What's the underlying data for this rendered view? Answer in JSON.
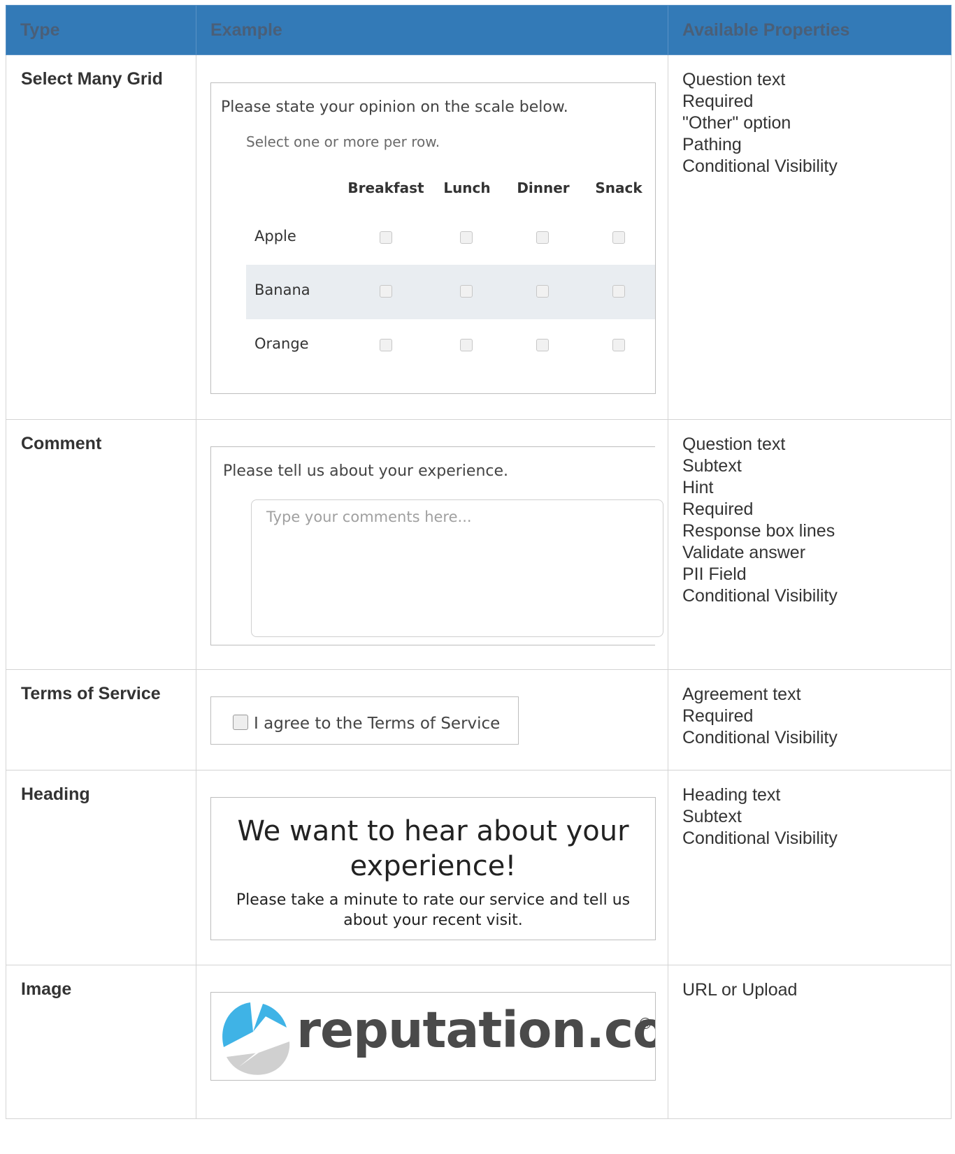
{
  "headers": {
    "type": "Type",
    "example": "Example",
    "props": "Available Properties"
  },
  "rows": [
    {
      "type": "Select Many Grid",
      "example": {
        "question": "Please state your opinion on the scale below.",
        "subtext": "Select one or more per row.",
        "columns": [
          "Breakfast",
          "Lunch",
          "Dinner",
          "Snack"
        ],
        "rows": [
          "Apple",
          "Banana",
          "Orange"
        ]
      },
      "props": [
        "Question text",
        "Required",
        "\"Other\" option",
        "Pathing",
        "Conditional Visibility"
      ]
    },
    {
      "type": "Comment",
      "example": {
        "question": "Please tell us about your experience.",
        "placeholder": "Type your comments here..."
      },
      "props": [
        "Question text",
        "Subtext",
        "Hint",
        "Required",
        "Response box lines",
        "Validate answer",
        "PII Field",
        "Conditional Visibility"
      ]
    },
    {
      "type": "Terms of Service",
      "example": {
        "label": "I agree to the Terms of Service"
      },
      "props": [
        "Agreement text",
        "Required",
        "Conditional Visibility"
      ]
    },
    {
      "type": "Heading",
      "example": {
        "heading_line1": "We want to hear about your",
        "heading_line2": "experience!",
        "subtext_line1": "Please take a minute to rate our service and tell us",
        "subtext_line2": "about your recent visit."
      },
      "props": [
        "Heading text",
        "Subtext",
        "Conditional Visibility"
      ]
    },
    {
      "type": "Image",
      "example": {
        "logo_text": "reputation.com",
        "logo_mark": "®"
      },
      "props": [
        "URL or Upload"
      ]
    }
  ],
  "colors": {
    "header_bg": "#337ab7",
    "header_text": "#4a5f78",
    "row_highlight": "#e9edf1",
    "logo_blue": "#3fb3e6",
    "logo_grey": "#d0d0d0"
  }
}
